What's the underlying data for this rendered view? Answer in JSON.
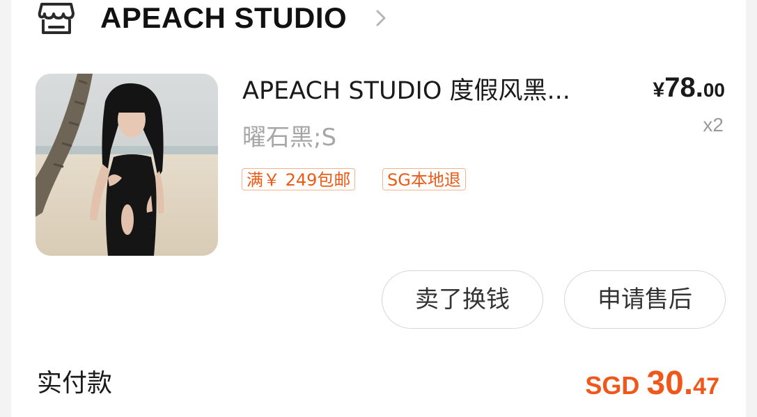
{
  "shop": {
    "name": "APEACH STUDIO",
    "icon": "store-icon",
    "chevron": "chevron-right-icon"
  },
  "product": {
    "title": "APEACH STUDIO 度假风黑...",
    "sku": "曜石黑;S",
    "price": {
      "currency": "¥",
      "integer": "78.",
      "decimal": "00"
    },
    "quantity": "x2",
    "tags": [
      "满￥ 249包邮",
      "SG本地退"
    ],
    "image": "product-photo-black-swimsuit-beach"
  },
  "actions": {
    "sell_label": "卖了换钱",
    "after_sales_label": "申请售后"
  },
  "total": {
    "label": "实付款",
    "currency": "SGD ",
    "integer": "30.",
    "decimal": "47"
  },
  "colors": {
    "accent": "#f0581b",
    "tag_border": "#f2b48f",
    "muted_text": "#a6a6a6",
    "background": "#f3f3f3"
  }
}
